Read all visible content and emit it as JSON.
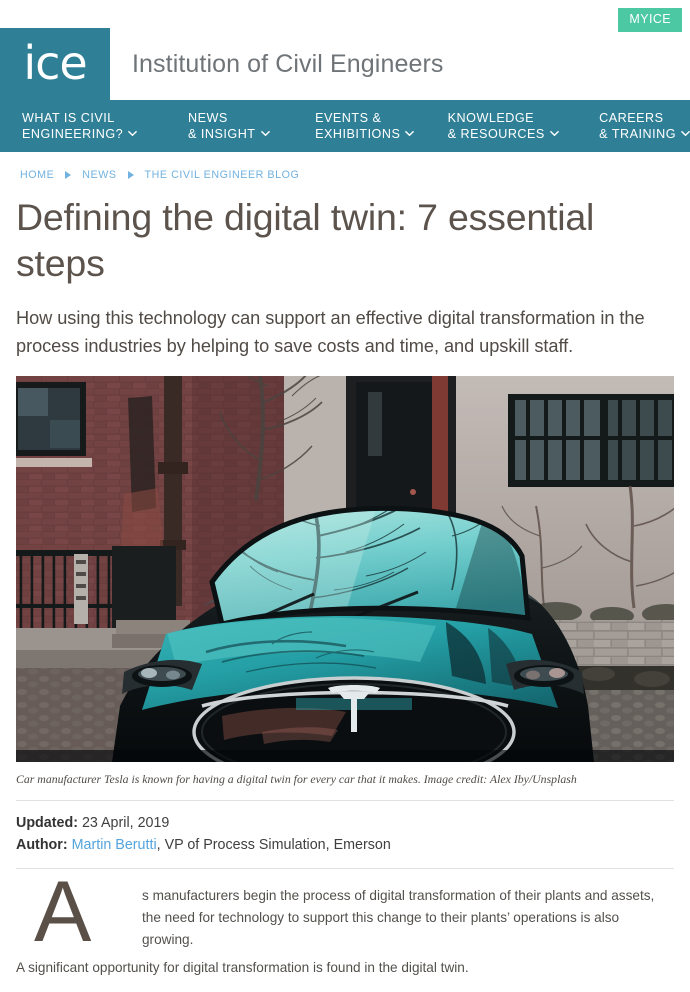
{
  "header": {
    "myice_label": "MYICE",
    "logo_text": "ice",
    "tagline": "Institution of Civil Engineers",
    "logo_bg": "#2f7f96",
    "myice_bg": "#4cc8a3"
  },
  "nav": {
    "bg": "#2f7f96",
    "items": [
      {
        "line1": "WHAT IS CIVIL",
        "line2": "ENGINEERING?",
        "has_chevron": true
      },
      {
        "line1": "NEWS",
        "line2": "& INSIGHT",
        "has_chevron": true
      },
      {
        "line1": "EVENTS &",
        "line2": "EXHIBITIONS",
        "has_chevron": true
      },
      {
        "line1": "KNOWLEDGE",
        "line2": "& RESOURCES",
        "has_chevron": true
      },
      {
        "line1": "CAREERS",
        "line2": "& TRAINING",
        "has_chevron": true
      }
    ]
  },
  "breadcrumb": {
    "color": "#72b2e0",
    "items": [
      "HOME",
      "NEWS",
      "THE CIVIL ENGINEER BLOG"
    ]
  },
  "article": {
    "title": "Defining the digital twin: 7 essential steps",
    "standfirst": "How using this technology can support an effective digital transformation in the process industries by helping to save costs and time, and upskill staff.",
    "image_caption": "Car manufacturer Tesla is known for having a digital twin for every car that it makes. Image credit: Alex Iby/Unsplash",
    "meta": {
      "updated_label": "Updated:",
      "updated_value": "23 April, 2019",
      "author_label": "Author:",
      "author_link": "Martin Berutti",
      "author_rest": ", VP of Process Simulation, Emerson",
      "link_color": "#54a4dd"
    },
    "body": {
      "dropcap": "A",
      "paragraph_1": "s manufacturers begin the process of digital transformation of their plants and assets, the need for technology to support this change to their plants’ operations is also growing.",
      "paragraph_2": "A significant opportunity for digital transformation is found in the digital twin."
    }
  },
  "hero_image": {
    "alt": "Dark Tesla Model S parked on a cobblestone street, windshield and hood reflecting bare tree branches in teal tones, brick building and iron railings behind.",
    "palette": {
      "teal_glass": "#7fd4d2",
      "teal_hood": "#2aa3a8",
      "car_black": "#121617",
      "brick": "#6e3f3f",
      "stone": "#b9b2ad",
      "cobble": "#6e6a66"
    }
  }
}
